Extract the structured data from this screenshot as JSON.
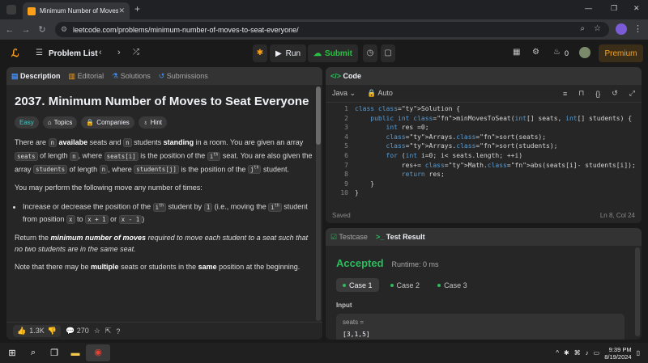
{
  "browser": {
    "tab_title": "Minimum Number of Moves to Seat Everyone - LeetCode",
    "tab_close": "✕",
    "new_tab": "+",
    "url": "leetcode.com/problems/minimum-number-of-moves-to-seat-everyone/",
    "window_min": "—",
    "window_max": "❐",
    "window_close": "✕"
  },
  "nav": {
    "problem_list": "Problem List",
    "run_label": "Run",
    "submit_label": "Submit",
    "streak_count": "0",
    "premium_label": "Premium"
  },
  "description_tabs": [
    "Description",
    "Editorial",
    "Solutions",
    "Submissions"
  ],
  "problem": {
    "title": "2037. Minimum Number of Moves to Seat Everyone",
    "tags": [
      "Easy",
      "Topics",
      "Companies",
      "Hint"
    ],
    "p1_a": "There are ",
    "p1_n": "n",
    "p1_b": " availabe",
    "p1_c": " seats and ",
    "p1_d": " students ",
    "p1_e": "standing",
    "p1_f": " in a room. You are given an array ",
    "seats_code": "seats",
    "p1_g": " of length ",
    "p1_h": ", where ",
    "seats_i_code": "seats[i]",
    "p1_i": " is the position of the ",
    "ith_code": "ith",
    "p1_j": " seat. You are also given the array ",
    "students_code": "students",
    "p1_k": " of length ",
    "p1_l": ", where ",
    "students_j_code": "students[j]",
    "p1_m": " is the position of the ",
    "jth_code": "jth",
    "p1_o": " student.",
    "p2": "You may perform the following move any number of times:",
    "li_a": "Increase or decrease the position of the ",
    "li_b": " student by ",
    "one_code": "1",
    "li_c": " (i.e., moving the ",
    "li_d": " student from position ",
    "x_code": "x",
    "li_e": " to ",
    "x1_code": "x + 1",
    "li_f": " or ",
    "x2_code": "x - 1",
    "li_g": ")",
    "p3_a": "Return the ",
    "p3_b": "minimum number of moves",
    "p3_c": " required to move each student to a seat such that no two students are in the same seat.",
    "p4_a": "Note that there may be ",
    "p4_b": "multiple",
    "p4_c": " seats or students in the ",
    "p4_d": "same",
    "p4_e": " position at the beginning."
  },
  "desc_footer": {
    "likes": "1.3K",
    "comments": "270"
  },
  "code_panel": {
    "tab_label": "Code",
    "language": "Java",
    "mode": "Auto",
    "status": "Saved",
    "cursor": "Ln 8, Col 24",
    "lines": [
      "class Solution {",
      "    public int minMovesToSeat(int[] seats, int[] students) {",
      "        int res =0;",
      "        Arrays.sort(seats);",
      "        Arrays.sort(students);",
      "        for (int i=0; i< seats.length; ++i)",
      "            res+= Math.abs(seats[i]- students[i]);",
      "            return res;",
      "    }",
      "}"
    ]
  },
  "result_panel": {
    "tabs": [
      "Testcase",
      "Test Result"
    ],
    "verdict": "Accepted",
    "runtime": "Runtime: 0 ms",
    "cases": [
      "Case 1",
      "Case 2",
      "Case 3"
    ],
    "input_label": "Input",
    "var_name": "seats =",
    "var_value": "[3,1,5]"
  },
  "taskbar": {
    "time": "9:39 PM",
    "date": "8/19/2024"
  },
  "colors": {
    "accent_orange": "#ffa116",
    "accepted_green": "#2cbb5d",
    "easy_teal": "#46c6c2"
  }
}
